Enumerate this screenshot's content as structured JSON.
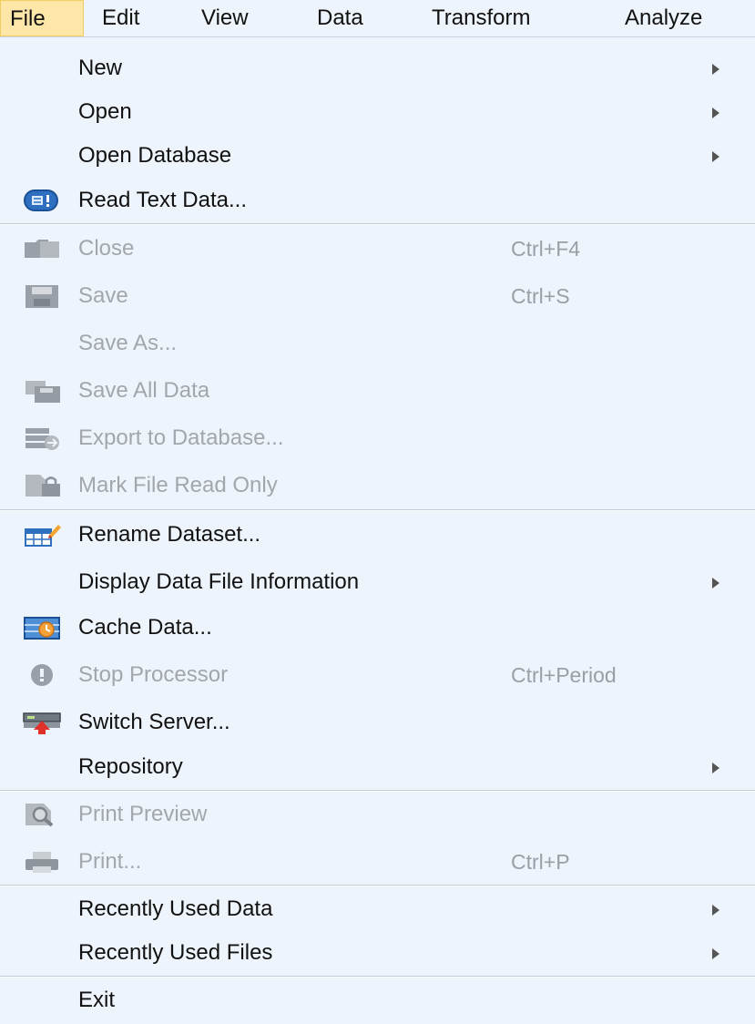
{
  "menubar": {
    "file": "File",
    "edit": "Edit",
    "view": "View",
    "data": "Data",
    "transform": "Transform",
    "analyze": "Analyze"
  },
  "file_menu": {
    "new": {
      "label": "New",
      "submenu": true
    },
    "open": {
      "label": "Open",
      "submenu": true
    },
    "open_database": {
      "label": "Open Database",
      "submenu": true
    },
    "read_text_data": {
      "label": "Read Text Data...",
      "icon": "read-text-data-icon"
    },
    "close": {
      "label": "Close",
      "shortcut": "Ctrl+F4",
      "enabled": false,
      "icon": "close-icon"
    },
    "save": {
      "label": "Save",
      "shortcut": "Ctrl+S",
      "enabled": false,
      "icon": "save-icon"
    },
    "save_as": {
      "label": "Save As...",
      "enabled": false
    },
    "save_all_data": {
      "label": "Save All Data",
      "enabled": false,
      "icon": "save-all-icon"
    },
    "export_to_database": {
      "label": "Export to Database...",
      "enabled": false,
      "icon": "export-database-icon"
    },
    "mark_file_read_only": {
      "label": "Mark File Read Only",
      "enabled": false,
      "icon": "mark-read-only-icon"
    },
    "rename_dataset": {
      "label": "Rename Dataset...",
      "icon": "rename-dataset-icon"
    },
    "display_data_file_information": {
      "label": "Display Data File Information",
      "submenu": true
    },
    "cache_data": {
      "label": "Cache Data...",
      "icon": "cache-data-icon"
    },
    "stop_processor": {
      "label": "Stop Processor",
      "shortcut": "Ctrl+Period",
      "enabled": false,
      "icon": "stop-processor-icon"
    },
    "switch_server": {
      "label": "Switch Server...",
      "icon": "switch-server-icon"
    },
    "repository": {
      "label": "Repository",
      "submenu": true
    },
    "print_preview": {
      "label": "Print Preview",
      "enabled": false,
      "icon": "print-preview-icon"
    },
    "print": {
      "label": "Print...",
      "shortcut": "Ctrl+P",
      "enabled": false,
      "icon": "printer-icon"
    },
    "recently_used_data": {
      "label": "Recently Used Data",
      "submenu": true
    },
    "recently_used_files": {
      "label": "Recently Used Files",
      "submenu": true
    },
    "exit": {
      "label": "Exit"
    }
  },
  "colors": {
    "menu_bg": "#eef4fb",
    "active_top_item": "#fde7a8",
    "disabled_text": "#a2a7ad"
  }
}
